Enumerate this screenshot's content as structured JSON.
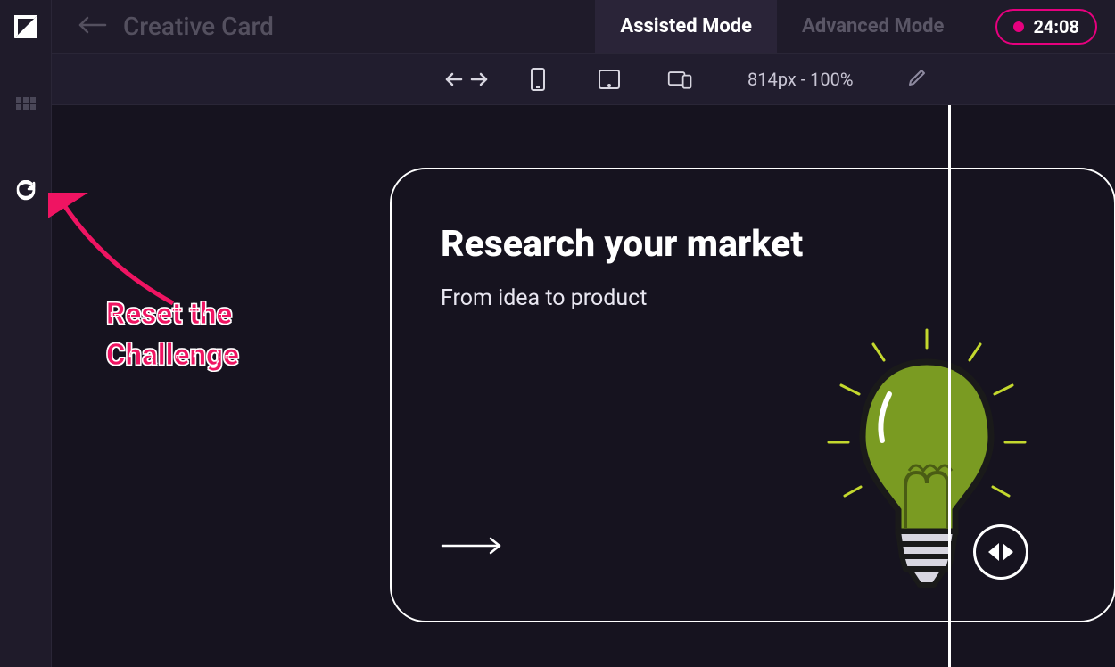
{
  "header": {
    "title": "Creative Card",
    "tabs": [
      {
        "label": "Assisted Mode",
        "active": true
      },
      {
        "label": "Advanced Mode",
        "active": false
      }
    ],
    "timer": "24:08"
  },
  "toolbar": {
    "zoom_label": "814px - 100%"
  },
  "card": {
    "heading": "Research your market",
    "subheading": "From idea to product"
  },
  "annotation": {
    "line1": "Reset the",
    "line2": "Challenge"
  },
  "colors": {
    "accent_pink": "#e6007e",
    "annotation": "#ef1462",
    "bulb_fill": "#7a9b22"
  }
}
